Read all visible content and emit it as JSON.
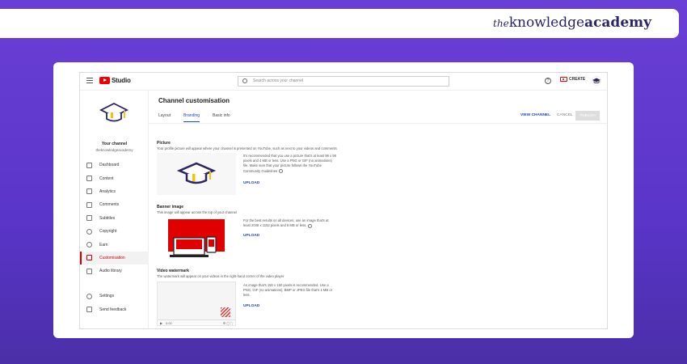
{
  "brand": {
    "prefix": "the",
    "word1": "knowledge",
    "word2": "academy"
  },
  "studio": {
    "logo_text": "Studio",
    "search_placeholder": "Search across your channel",
    "help_icon": "?",
    "create_label": "CREATE"
  },
  "sidebar": {
    "channel_title": "Your channel",
    "channel_handle": "theknowledgeacademy",
    "items": [
      {
        "label": "Dashboard",
        "icon": "dashboard-icon"
      },
      {
        "label": "Content",
        "icon": "content-icon"
      },
      {
        "label": "Analytics",
        "icon": "analytics-icon"
      },
      {
        "label": "Comments",
        "icon": "comments-icon"
      },
      {
        "label": "Subtitles",
        "icon": "subtitles-icon"
      },
      {
        "label": "Copyright",
        "icon": "copyright-icon"
      },
      {
        "label": "Earn",
        "icon": "earn-icon"
      },
      {
        "label": "Customisation",
        "icon": "customisation-icon"
      },
      {
        "label": "Audio library",
        "icon": "audio-library-icon"
      }
    ],
    "bottom_items": [
      {
        "label": "Settings",
        "icon": "gear-icon"
      },
      {
        "label": "Send feedback",
        "icon": "feedback-icon"
      }
    ]
  },
  "main": {
    "title": "Channel customisation",
    "tabs": [
      "Layout",
      "Branding",
      "Basic info"
    ],
    "active_tab": "Branding",
    "view_channel": "VIEW CHANNEL",
    "cancel": "CANCEL",
    "publish": "PUBLISH",
    "picture": {
      "title": "Picture",
      "desc": "Your profile picture will appear where your channel is presented on YouTube, such as next to your videos and comments",
      "text": "It's recommended that you use a picture that's at least 98 x 98 pixels and 4 MB or less. Use a PNG or GIF (no animations) file. Make sure that your picture follows the YouTube Community Guidelines",
      "upload": "UPLOAD"
    },
    "banner": {
      "title": "Banner image",
      "desc": "This image will appear across the top of your channel",
      "text": "For the best results on all devices, use an image that's at least 2048 x 1152 pixels and 6 MB or less.",
      "upload": "UPLOAD"
    },
    "watermark": {
      "title": "Video watermark",
      "desc": "The watermark will appear on your videos in the right-hand corner of the video player",
      "text": "An image that's 150 x 150 pixels is recommended. Use a PNG, GIF (no animations), BMP or JPEG file that's 1 MB or less.",
      "upload": "UPLOAD",
      "player_time": "0:00"
    }
  },
  "colors": {
    "accent_blue": "#1a47c9",
    "youtube_red": "#e00000",
    "background_purple": "#5a35c9",
    "brand_navy": "#2b2467"
  }
}
